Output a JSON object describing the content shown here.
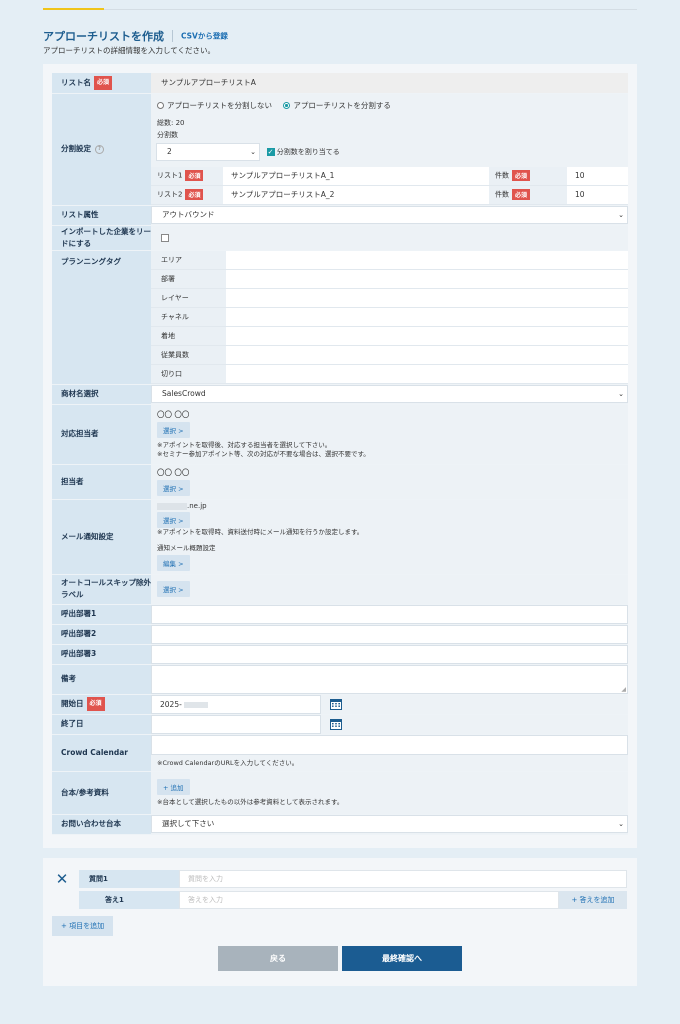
{
  "header": {
    "title": "アプローチリストを作成",
    "csv_link": "CSVから登録",
    "subtitle": "アプローチリストの詳細情報を入力してください。"
  },
  "required_badge": "必須",
  "form": {
    "list_name": {
      "label": "リスト名",
      "value": "サンプルアプローチリストA"
    },
    "split": {
      "label": "分割設定",
      "option_no": "アプローチリストを分割しない",
      "option_yes": "アプローチリストを分割する",
      "total_label": "総数: 20",
      "count_label": "分割数",
      "count_value": "2",
      "assign_label": "分割数を割り当てる",
      "lists": [
        {
          "label": "リスト1",
          "name": "サンプルアプローチリストA_1",
          "count_label": "件数",
          "count": "10"
        },
        {
          "label": "リスト2",
          "name": "サンプルアプローチリストA_2",
          "count_label": "件数",
          "count": "10"
        }
      ]
    },
    "list_attr": {
      "label": "リスト属性",
      "value": "アウトバウンド"
    },
    "import_lead": {
      "label": "インポートした企業をリードにする"
    },
    "planning_tag": {
      "label": "プランニングタグ",
      "tags": [
        "エリア",
        "部署",
        "レイヤー",
        "チャネル",
        "着地",
        "従業員数",
        "切り口"
      ]
    },
    "product": {
      "label": "商材名選択",
      "value": "SalesCrowd"
    },
    "handler": {
      "label": "対応担当者",
      "name": "〇〇 〇〇",
      "select_btn": "選択 >",
      "note1": "※アポイントを取得後、対応する担当者を選択して下さい。",
      "note2": "※セミナー参加アポイント等、次の対応が不要な場合は、選択不要です。"
    },
    "owner": {
      "label": "担当者",
      "name": "〇〇 〇〇",
      "select_btn": "選択 >"
    },
    "mail": {
      "label": "メール通知設定",
      "email": ".ne.jp",
      "select_btn": "選択 >",
      "note": "※アポイントを取得時、資料送付時にメール通知を行うか設定します。",
      "subject_label": "通知メール概題設定",
      "edit_btn": "編集 >"
    },
    "autocall": {
      "label": "オートコールスキップ除外ラベル",
      "select_btn": "選択 >"
    },
    "dept1": {
      "label": "呼出部署1"
    },
    "dept2": {
      "label": "呼出部署2"
    },
    "dept3": {
      "label": "呼出部署3"
    },
    "remarks": {
      "label": "備考"
    },
    "start_date": {
      "label": "開始日",
      "value": "2025-"
    },
    "end_date": {
      "label": "終了日"
    },
    "crowd_calendar": {
      "label": "Crowd Calendar",
      "note": "※Crowd CalendarのURLを入力してください。"
    },
    "script": {
      "label": "台本/参考資料",
      "add_btn": "+ 追加",
      "note": "※台本として選択したもの以外は参考資料として表示されます。"
    },
    "inquiry_script": {
      "label": "お問い合わせ台本",
      "value": "選択して下さい"
    }
  },
  "qa": {
    "question_label": "質問1",
    "question_placeholder": "質問を入力",
    "answer_label": "答え1",
    "answer_placeholder": "答えを入力",
    "add_answer": "+ 答えを追加",
    "add_item": "+ 項目を追加"
  },
  "buttons": {
    "back": "戻る",
    "confirm": "最終確認へ"
  }
}
